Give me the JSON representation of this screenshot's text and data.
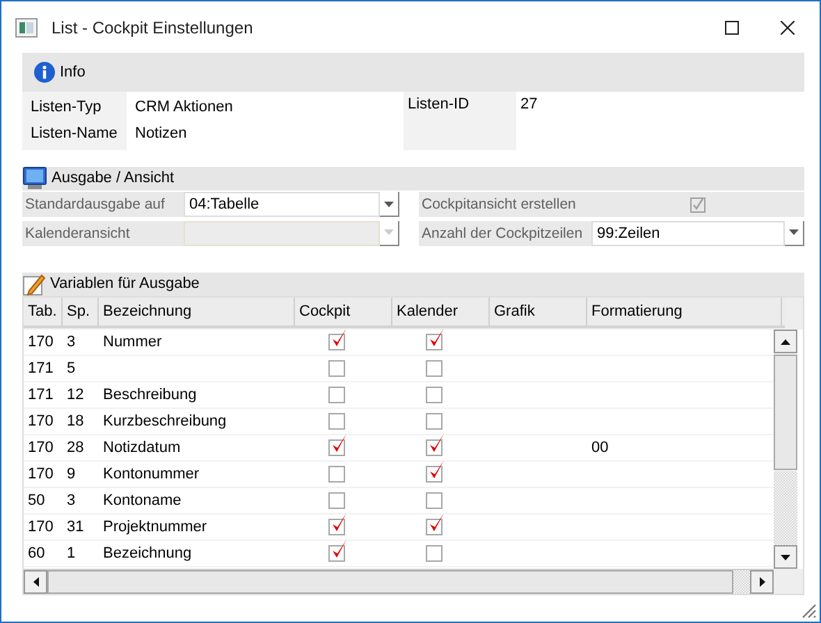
{
  "window": {
    "title": "List - Cockpit Einstellungen"
  },
  "info": {
    "title": "Info",
    "fields": [
      {
        "label": "Listen-Typ",
        "value": "CRM Aktionen"
      },
      {
        "label": "Listen-Name",
        "value": "Notizen"
      }
    ],
    "id_label": "Listen-ID",
    "id_value": "27"
  },
  "output": {
    "title": "Ausgabe / Ansicht",
    "fields": [
      {
        "kind": "combo",
        "label": "Standardausgabe auf",
        "value": "04:Tabelle",
        "disabled": false
      },
      {
        "kind": "checkbox",
        "label": "Cockpitansicht erstellen",
        "checked": true,
        "disabled": true
      },
      {
        "kind": "combo",
        "label": "Kalenderansicht",
        "disabled": true
      },
      {
        "kind": "combo",
        "label": "Anzahl der Cockpitzeilen",
        "value": "99:Zeilen",
        "disabled": false
      }
    ]
  },
  "variables": {
    "title": "Variablen für Ausgabe",
    "columns": [
      "Tab.",
      "Sp.",
      "Bezeichnung",
      "Cockpit",
      "Kalender",
      "Grafik",
      "Formatierung"
    ],
    "rows": [
      {
        "tab": "170",
        "sp": "3",
        "name": "Nummer",
        "cockpit": true,
        "calendar": true
      },
      {
        "tab": "171",
        "sp": "5",
        "cockpit": false,
        "calendar": false
      },
      {
        "tab": "171",
        "sp": "12",
        "name": "Beschreibung",
        "cockpit": false,
        "calendar": false
      },
      {
        "tab": "170",
        "sp": "18",
        "name": "Kurzbeschreibung",
        "cockpit": false,
        "calendar": false
      },
      {
        "tab": "170",
        "sp": "28",
        "name": "Notizdatum",
        "cockpit": true,
        "calendar": true,
        "format": "00"
      },
      {
        "tab": "170",
        "sp": "9",
        "name": "Kontonummer",
        "cockpit": false,
        "calendar": true
      },
      {
        "tab": "50",
        "sp": "3",
        "name": "Kontoname",
        "cockpit": false,
        "calendar": false
      },
      {
        "tab": "170",
        "sp": "31",
        "name": "Projektnummer",
        "cockpit": true,
        "calendar": true
      },
      {
        "tab": "60",
        "sp": "1",
        "name": "Bezeichnung",
        "cockpit": true,
        "calendar": false
      }
    ]
  }
}
